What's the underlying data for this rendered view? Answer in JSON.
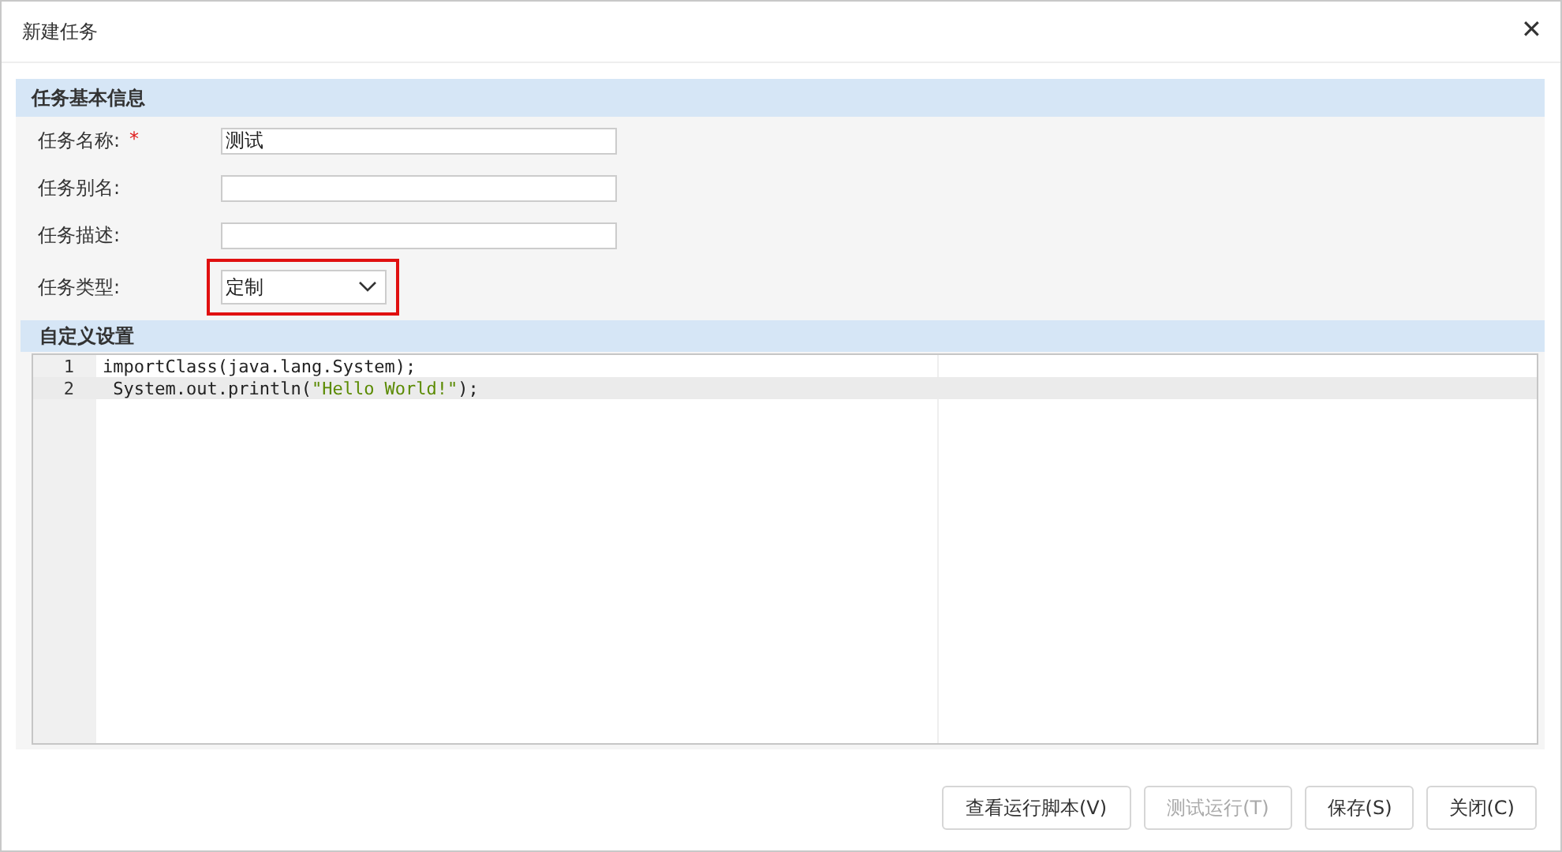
{
  "window": {
    "title": "新建任务",
    "close": "✕"
  },
  "basic_section": {
    "title": "任务基本信息",
    "fields": [
      {
        "kind": "text",
        "label": "任务名称:",
        "required": true,
        "required_mark": "*",
        "value": "测试"
      },
      {
        "kind": "text",
        "label": "任务别名:"
      },
      {
        "kind": "text",
        "label": "任务描述:"
      },
      {
        "kind": "select",
        "label": "任务类型:",
        "value": "定制",
        "highlighted": true
      }
    ]
  },
  "custom_section": {
    "title": "自定义设置",
    "code_lines": [
      {
        "number": "1",
        "active": false,
        "tokens": [
          {
            "kind": "plain",
            "text": "importClass(java.lang.System);"
          }
        ]
      },
      {
        "number": "2",
        "active": true,
        "tokens": [
          {
            "kind": "plain",
            "text": " System.out.println("
          },
          {
            "kind": "string",
            "text": "\"Hello World!\""
          },
          {
            "kind": "plain",
            "text": ");"
          }
        ]
      }
    ]
  },
  "buttons": [
    {
      "label": "查看运行脚本(V)",
      "disabled": false
    },
    {
      "label": "测试运行(T)",
      "disabled": true
    },
    {
      "label": "保存(S)",
      "disabled": false
    },
    {
      "label": "关闭(C)",
      "disabled": false
    }
  ]
}
